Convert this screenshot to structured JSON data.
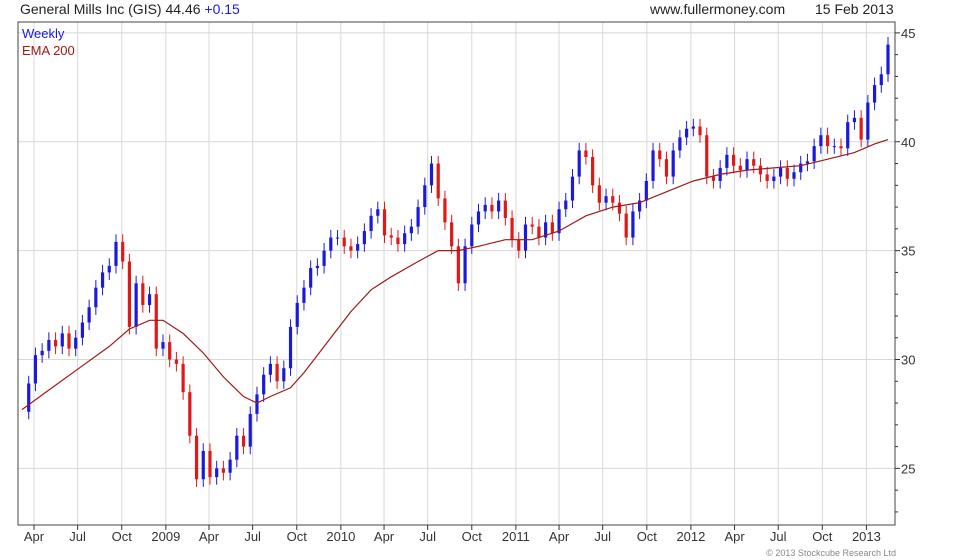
{
  "header": {
    "title": "General Mills Inc (GIS) 44.46",
    "change": "+0.15",
    "site": "www.fullermoney.com",
    "date": "15 Feb 2013"
  },
  "legend": {
    "period": "Weekly",
    "ema": "EMA 200"
  },
  "copyright": "© 2013 Stockcube Research Ltd",
  "colors": {
    "up": "#1a1adc",
    "down": "#e01818",
    "ema": "#a01818",
    "grid": "#d8d8d8",
    "axis": "#333333",
    "title": "#222222",
    "change": "#1a1adc",
    "period": "#1a1adc",
    "ema_label": "#a01818"
  },
  "chart_data": {
    "type": "candlestick",
    "title": "General Mills Inc (GIS) 44.46 +0.15",
    "xlabel": "",
    "ylabel": "",
    "ylim": [
      22.4,
      45.5
    ],
    "yticks": [
      25,
      30,
      35,
      40,
      45
    ],
    "grid": true,
    "x_start": "2008-03-07",
    "x_end": "2013-02-15",
    "x_ticks": [
      {
        "label": "Apr",
        "date": "2008-04-01"
      },
      {
        "label": "Jul",
        "date": "2008-07-01"
      },
      {
        "label": "Oct",
        "date": "2008-10-01"
      },
      {
        "label": "2009",
        "date": "2009-01-01"
      },
      {
        "label": "Apr",
        "date": "2009-04-01"
      },
      {
        "label": "Jul",
        "date": "2009-07-01"
      },
      {
        "label": "Oct",
        "date": "2009-10-01"
      },
      {
        "label": "2010",
        "date": "2010-01-01"
      },
      {
        "label": "Apr",
        "date": "2010-04-01"
      },
      {
        "label": "Jul",
        "date": "2010-07-01"
      },
      {
        "label": "Oct",
        "date": "2010-10-01"
      },
      {
        "label": "2011",
        "date": "2011-01-01"
      },
      {
        "label": "Apr",
        "date": "2011-04-01"
      },
      {
        "label": "Jul",
        "date": "2011-07-01"
      },
      {
        "label": "Oct",
        "date": "2011-10-01"
      },
      {
        "label": "2012",
        "date": "2012-01-01"
      },
      {
        "label": "Apr",
        "date": "2012-04-01"
      },
      {
        "label": "Jul",
        "date": "2012-07-01"
      },
      {
        "label": "Oct",
        "date": "2012-10-01"
      },
      {
        "label": "2013",
        "date": "2013-01-01"
      }
    ],
    "series": [
      {
        "name": "Weekly",
        "kind": "close",
        "points": [
          [
            "2008-03-07",
            27.6
          ],
          [
            "2008-03-21",
            28.9
          ],
          [
            "2008-04-04",
            30.2
          ],
          [
            "2008-04-18",
            30.4
          ],
          [
            "2008-05-02",
            30.9
          ],
          [
            "2008-05-16",
            30.6
          ],
          [
            "2008-05-30",
            31.2
          ],
          [
            "2008-06-13",
            30.5
          ],
          [
            "2008-06-27",
            31.0
          ],
          [
            "2008-07-11",
            31.7
          ],
          [
            "2008-07-25",
            32.4
          ],
          [
            "2008-08-08",
            33.3
          ],
          [
            "2008-08-22",
            34.0
          ],
          [
            "2008-09-05",
            34.3
          ],
          [
            "2008-09-19",
            35.4
          ],
          [
            "2008-10-03",
            34.5
          ],
          [
            "2008-10-17",
            31.5
          ],
          [
            "2008-10-31",
            33.5
          ],
          [
            "2008-11-14",
            32.5
          ],
          [
            "2008-11-28",
            33.0
          ],
          [
            "2008-12-12",
            30.5
          ],
          [
            "2008-12-26",
            30.8
          ],
          [
            "2009-01-09",
            30.0
          ],
          [
            "2009-01-23",
            29.8
          ],
          [
            "2009-02-06",
            28.5
          ],
          [
            "2009-02-20",
            26.5
          ],
          [
            "2009-03-06",
            24.5
          ],
          [
            "2009-03-20",
            25.8
          ],
          [
            "2009-04-03",
            24.6
          ],
          [
            "2009-04-17",
            25.0
          ],
          [
            "2009-05-01",
            24.8
          ],
          [
            "2009-05-15",
            25.4
          ],
          [
            "2009-05-29",
            26.5
          ],
          [
            "2009-06-12",
            26.0
          ],
          [
            "2009-06-26",
            27.5
          ],
          [
            "2009-07-10",
            28.4
          ],
          [
            "2009-07-24",
            29.3
          ],
          [
            "2009-08-07",
            29.8
          ],
          [
            "2009-08-21",
            29.0
          ],
          [
            "2009-09-04",
            29.6
          ],
          [
            "2009-09-18",
            31.5
          ],
          [
            "2009-10-02",
            32.6
          ],
          [
            "2009-10-16",
            33.3
          ],
          [
            "2009-10-30",
            34.2
          ],
          [
            "2009-11-13",
            34.3
          ],
          [
            "2009-11-27",
            35.0
          ],
          [
            "2009-12-11",
            35.6
          ],
          [
            "2009-12-25",
            35.6
          ],
          [
            "2010-01-08",
            35.2
          ],
          [
            "2010-01-22",
            35.0
          ],
          [
            "2010-02-05",
            35.3
          ],
          [
            "2010-02-19",
            35.9
          ],
          [
            "2010-03-05",
            36.6
          ],
          [
            "2010-03-19",
            36.9
          ],
          [
            "2010-04-02",
            35.7
          ],
          [
            "2010-04-16",
            35.6
          ],
          [
            "2010-04-30",
            35.3
          ],
          [
            "2010-05-14",
            35.8
          ],
          [
            "2010-05-28",
            36.1
          ],
          [
            "2010-06-11",
            37.0
          ],
          [
            "2010-06-25",
            38.0
          ],
          [
            "2010-07-09",
            39.0
          ],
          [
            "2010-07-23",
            37.4
          ],
          [
            "2010-08-06",
            36.3
          ],
          [
            "2010-08-20",
            35.2
          ],
          [
            "2010-09-03",
            33.5
          ],
          [
            "2010-09-17",
            35.2
          ],
          [
            "2010-10-01",
            36.2
          ],
          [
            "2010-10-15",
            36.8
          ],
          [
            "2010-10-29",
            37.1
          ],
          [
            "2010-11-12",
            36.8
          ],
          [
            "2010-11-26",
            37.3
          ],
          [
            "2010-12-10",
            36.5
          ],
          [
            "2010-12-24",
            35.5
          ],
          [
            "2011-01-07",
            35.0
          ],
          [
            "2011-01-21",
            36.2
          ],
          [
            "2011-02-04",
            36.1
          ],
          [
            "2011-02-18",
            35.6
          ],
          [
            "2011-03-04",
            36.3
          ],
          [
            "2011-03-18",
            35.8
          ],
          [
            "2011-04-01",
            36.9
          ],
          [
            "2011-04-15",
            37.3
          ],
          [
            "2011-04-29",
            38.4
          ],
          [
            "2011-05-13",
            39.6
          ],
          [
            "2011-05-27",
            39.3
          ],
          [
            "2011-06-10",
            38.0
          ],
          [
            "2011-06-24",
            37.2
          ],
          [
            "2011-07-08",
            37.5
          ],
          [
            "2011-07-22",
            37.2
          ],
          [
            "2011-08-05",
            36.7
          ],
          [
            "2011-08-19",
            35.6
          ],
          [
            "2011-09-02",
            36.8
          ],
          [
            "2011-09-16",
            37.3
          ],
          [
            "2011-09-30",
            38.2
          ],
          [
            "2011-10-14",
            39.6
          ],
          [
            "2011-10-28",
            39.2
          ],
          [
            "2011-11-11",
            38.4
          ],
          [
            "2011-11-25",
            39.6
          ],
          [
            "2011-12-09",
            40.2
          ],
          [
            "2011-12-23",
            40.6
          ],
          [
            "2012-01-06",
            40.7
          ],
          [
            "2012-01-20",
            40.3
          ],
          [
            "2012-02-03",
            38.4
          ],
          [
            "2012-02-17",
            38.2
          ],
          [
            "2012-03-02",
            38.8
          ],
          [
            "2012-03-16",
            39.4
          ],
          [
            "2012-03-30",
            38.9
          ],
          [
            "2012-04-13",
            38.7
          ],
          [
            "2012-04-27",
            39.2
          ],
          [
            "2012-05-11",
            38.9
          ],
          [
            "2012-05-25",
            38.5
          ],
          [
            "2012-06-08",
            38.2
          ],
          [
            "2012-06-22",
            38.4
          ],
          [
            "2012-07-06",
            38.8
          ],
          [
            "2012-07-20",
            38.3
          ],
          [
            "2012-08-03",
            38.6
          ],
          [
            "2012-08-17",
            39.0
          ],
          [
            "2012-08-31",
            39.1
          ],
          [
            "2012-09-14",
            39.8
          ],
          [
            "2012-09-28",
            40.3
          ],
          [
            "2012-10-12",
            39.8
          ],
          [
            "2012-10-26",
            39.8
          ],
          [
            "2012-11-09",
            39.7
          ],
          [
            "2012-11-23",
            40.9
          ],
          [
            "2012-12-07",
            41.1
          ],
          [
            "2012-12-21",
            40.1
          ],
          [
            "2013-01-04",
            41.8
          ],
          [
            "2013-01-18",
            42.6
          ],
          [
            "2013-02-01",
            43.1
          ],
          [
            "2013-02-15",
            44.46
          ]
        ]
      },
      {
        "name": "EMA 200",
        "kind": "line",
        "points": [
          [
            "2008-03-07",
            27.7
          ],
          [
            "2008-05-02",
            28.6
          ],
          [
            "2008-07-04",
            29.6
          ],
          [
            "2008-09-05",
            30.6
          ],
          [
            "2008-10-17",
            31.4
          ],
          [
            "2008-11-28",
            31.8
          ],
          [
            "2008-12-26",
            31.8
          ],
          [
            "2009-02-06",
            31.2
          ],
          [
            "2009-03-20",
            30.3
          ],
          [
            "2009-05-01",
            29.2
          ],
          [
            "2009-06-12",
            28.3
          ],
          [
            "2009-07-10",
            28.0
          ],
          [
            "2009-08-07",
            28.3
          ],
          [
            "2009-09-18",
            28.7
          ],
          [
            "2009-10-16",
            29.4
          ],
          [
            "2009-11-13",
            30.2
          ],
          [
            "2009-12-11",
            31.0
          ],
          [
            "2010-01-22",
            32.2
          ],
          [
            "2010-03-05",
            33.2
          ],
          [
            "2010-04-16",
            33.8
          ],
          [
            "2010-06-11",
            34.5
          ],
          [
            "2010-07-23",
            35.0
          ],
          [
            "2010-09-03",
            35.0
          ],
          [
            "2010-10-15",
            35.2
          ],
          [
            "2010-12-10",
            35.5
          ],
          [
            "2011-02-04",
            35.5
          ],
          [
            "2011-04-01",
            35.9
          ],
          [
            "2011-05-27",
            36.6
          ],
          [
            "2011-07-22",
            37.0
          ],
          [
            "2011-09-16",
            37.2
          ],
          [
            "2011-11-11",
            37.7
          ],
          [
            "2012-01-06",
            38.2
          ],
          [
            "2012-03-02",
            38.5
          ],
          [
            "2012-04-27",
            38.7
          ],
          [
            "2012-06-22",
            38.8
          ],
          [
            "2012-08-17",
            38.9
          ],
          [
            "2012-10-12",
            39.2
          ],
          [
            "2012-12-07",
            39.5
          ],
          [
            "2013-01-18",
            39.9
          ],
          [
            "2013-02-15",
            40.1
          ]
        ]
      }
    ]
  }
}
